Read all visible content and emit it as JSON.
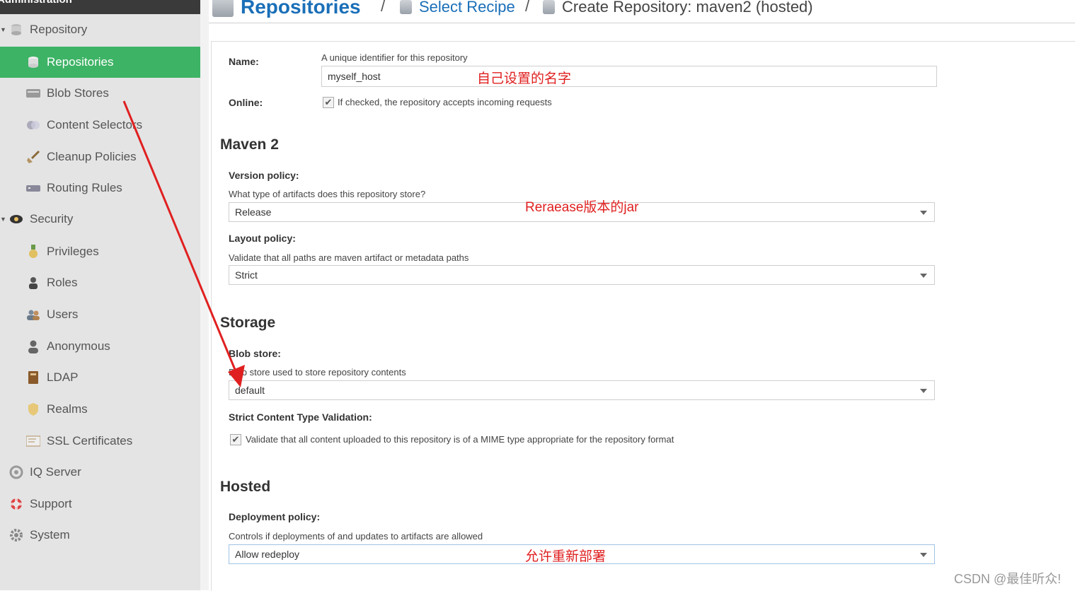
{
  "sidebar": {
    "header": "Administration",
    "items": [
      {
        "label": "Repository",
        "icon": "database-icon"
      },
      {
        "label": "Repositories",
        "icon": "database-icon"
      },
      {
        "label": "Blob Stores",
        "icon": "server-icon"
      },
      {
        "label": "Content Selectors",
        "icon": "selector-icon"
      },
      {
        "label": "Cleanup Policies",
        "icon": "broom-icon"
      },
      {
        "label": "Routing Rules",
        "icon": "router-icon"
      },
      {
        "label": "Security",
        "icon": "security-icon"
      },
      {
        "label": "Privileges",
        "icon": "medal-icon"
      },
      {
        "label": "Roles",
        "icon": "role-icon"
      },
      {
        "label": "Users",
        "icon": "users-icon"
      },
      {
        "label": "Anonymous",
        "icon": "anonymous-icon"
      },
      {
        "label": "LDAP",
        "icon": "book-icon"
      },
      {
        "label": "Realms",
        "icon": "shield-icon"
      },
      {
        "label": "SSL Certificates",
        "icon": "certificate-icon"
      },
      {
        "label": "IQ Server",
        "icon": "iq-icon"
      },
      {
        "label": "Support",
        "icon": "lifebuoy-icon"
      },
      {
        "label": "System",
        "icon": "gear-icon"
      }
    ]
  },
  "breadcrumb": {
    "root": "Repositories",
    "sep1": "/",
    "step2": "Select Recipe",
    "sep2": "/",
    "current": "Create Repository: maven2 (hosted)"
  },
  "form": {
    "name_label": "Name:",
    "name_help": "A unique identifier for this repository",
    "name_value": "myself_host",
    "online_label": "Online:",
    "online_text": "If checked, the repository accepts incoming requests",
    "maven_section": "Maven 2",
    "version_label": "Version policy:",
    "version_help": "What type of artifacts does this repository store?",
    "version_value": "Release",
    "layout_label": "Layout policy:",
    "layout_help": "Validate that all paths are maven artifact or metadata paths",
    "layout_value": "Strict",
    "storage_section": "Storage",
    "blob_label": "Blob store:",
    "blob_help": "Blob store used to store repository contents",
    "blob_value": "default",
    "strict_label": "Strict Content Type Validation:",
    "strict_text": "Validate that all content uploaded to this repository is of a MIME type appropriate for the repository format",
    "hosted_section": "Hosted",
    "deploy_label": "Deployment policy:",
    "deploy_help": "Controls if deployments of and updates to artifacts are allowed",
    "deploy_value": "Allow redeploy"
  },
  "annotations": {
    "name_note": "自己设置的名字",
    "version_note": "Reraease版本的jar",
    "deploy_note": "允许重新部署"
  },
  "watermark": "CSDN @最佳听众!",
  "colors": {
    "accent": "#3db365",
    "link": "#1a6fb8",
    "annotation": "#e02020"
  }
}
